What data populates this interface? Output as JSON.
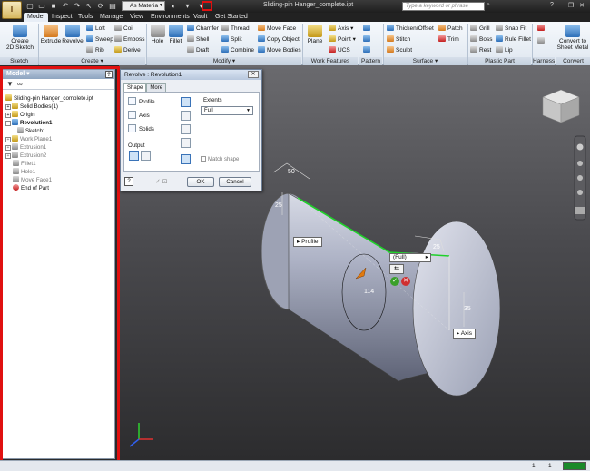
{
  "app_button": "I",
  "material": "As Materia",
  "document_title": "Sliding-pin Hanger_complete.ipt",
  "search_placeholder": "Type a keyword or phrase",
  "tabs": [
    "Model",
    "Inspect",
    "Tools",
    "Manage",
    "View",
    "Environments",
    "Vault",
    "Get Started"
  ],
  "ribbon": {
    "create_2d_sketch": "Create\n2D Sketch",
    "extrude": "Extrude",
    "revolve": "Revolve",
    "loft": "Loft",
    "sweep": "Sweep",
    "rib": "Rib",
    "coil": "Coil",
    "emboss": "Emboss",
    "derive": "Derive",
    "hole": "Hole",
    "fillet": "Fillet",
    "chamfer": "Chamfer",
    "shell": "Shell",
    "draft": "Draft",
    "thread": "Thread",
    "split": "Split",
    "combine": "Combine",
    "move_face": "Move Face",
    "copy_object": "Copy Object",
    "move_bodies": "Move Bodies",
    "plane": "Plane",
    "axis": "Axis",
    "point": "Point",
    "ucs": "UCS",
    "thicken": "Thicken/Offset",
    "stitch": "Stitch",
    "sculpt": "Sculpt",
    "patch": "Patch",
    "trim": "Trim",
    "grill": "Grill",
    "boss": "Boss",
    "rest": "Rest",
    "snap_fit": "Snap Fit",
    "rule_fillet": "Rule Fillet",
    "lip": "Lip",
    "convert_sheet_metal": "Convert to\nSheet Metal",
    "panels": {
      "sketch": "Sketch",
      "create": "Create ▾",
      "modify": "Modify ▾",
      "work_features": "Work Features",
      "pattern": "Pattern",
      "surface": "Surface ▾",
      "plastic_part": "Plastic Part",
      "harness": "Harness",
      "convert": "Convert"
    }
  },
  "browser": {
    "title": "Model ▾",
    "items": [
      "Sliding-pin Hanger_complete.ipt",
      "Solid Bodies(1)",
      "Origin",
      "Revolution1",
      "Sketch1",
      "Work Plane1",
      "Extrusion1",
      "Extrusion2",
      "Fillet1",
      "Hole1",
      "Move Face1",
      "End of Part"
    ]
  },
  "dialog": {
    "title": "Revolve : Revolution1",
    "tab_shape": "Shape",
    "tab_more": "More",
    "profile": "Profile",
    "axis": "Axis",
    "solids": "Solids",
    "output": "Output",
    "extents": "Extents",
    "extents_value": "Full",
    "match_shape": "Match shape",
    "ok": "OK",
    "cancel": "Cancel"
  },
  "viewport": {
    "dim_50": "50",
    "dim_25_left": "25",
    "dim_25_top": "25",
    "dim_114": "114",
    "dim_35": "35",
    "profile_label": "Profile",
    "axis_label": "Axis",
    "full_label": "(Full)"
  },
  "status": {
    "left_count": "1",
    "right_count": "1"
  }
}
